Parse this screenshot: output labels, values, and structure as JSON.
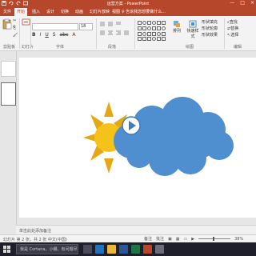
{
  "titlebar": {
    "title": "运营方案 - PowerPoint",
    "controls": [
      "—",
      "□",
      "×"
    ]
  },
  "tabs": [
    "文件",
    "开始",
    "插入",
    "设计",
    "切换",
    "动画",
    "幻灯片放映",
    "审阅",
    "视图"
  ],
  "tell_me": "♀ 告诉我您想要做什么...",
  "ribbon": {
    "groups": [
      "剪贴板",
      "幻灯片",
      "字体",
      "段落",
      "绘图",
      "编辑"
    ],
    "font_size": "18",
    "format_buttons": [
      "B",
      "I",
      "U",
      "S",
      "abc",
      "A"
    ],
    "buttons": {
      "arrange": "排列",
      "quick_styles": "快速样式",
      "shape_fill": "形状填充",
      "shape_outline": "形状轮廓",
      "shape_effects": "形状效果",
      "find": "查找",
      "replace": "替换",
      "select": "选择"
    }
  },
  "notes": {
    "placeholder": "单击此处添加备注"
  },
  "status": {
    "left": "幻灯片 第 2 张，共 2 张   中文(中国)",
    "notes": "备注",
    "comments": "批注",
    "zoom": "38%"
  },
  "taskbar": {
    "search": "我是 Cortana。小娜。有问题尽管问我。"
  },
  "colors": {
    "accent": "#b7472a",
    "cloud": "#4f8fd0",
    "sun": "#f5c21a",
    "sun_ray": "#e3a813"
  }
}
